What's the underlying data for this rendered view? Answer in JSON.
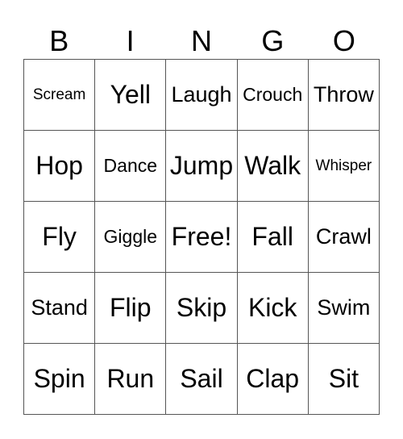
{
  "header": [
    "B",
    "I",
    "N",
    "G",
    "O"
  ],
  "rows": [
    [
      "Scream",
      "Yell",
      "Laugh",
      "Crouch",
      "Throw"
    ],
    [
      "Hop",
      "Dance",
      "Jump",
      "Walk",
      "Whisper"
    ],
    [
      "Fly",
      "Giggle",
      "Free!",
      "Fall",
      "Crawl"
    ],
    [
      "Stand",
      "Flip",
      "Skip",
      "Kick",
      "Swim"
    ],
    [
      "Spin",
      "Run",
      "Sail",
      "Clap",
      "Sit"
    ]
  ]
}
